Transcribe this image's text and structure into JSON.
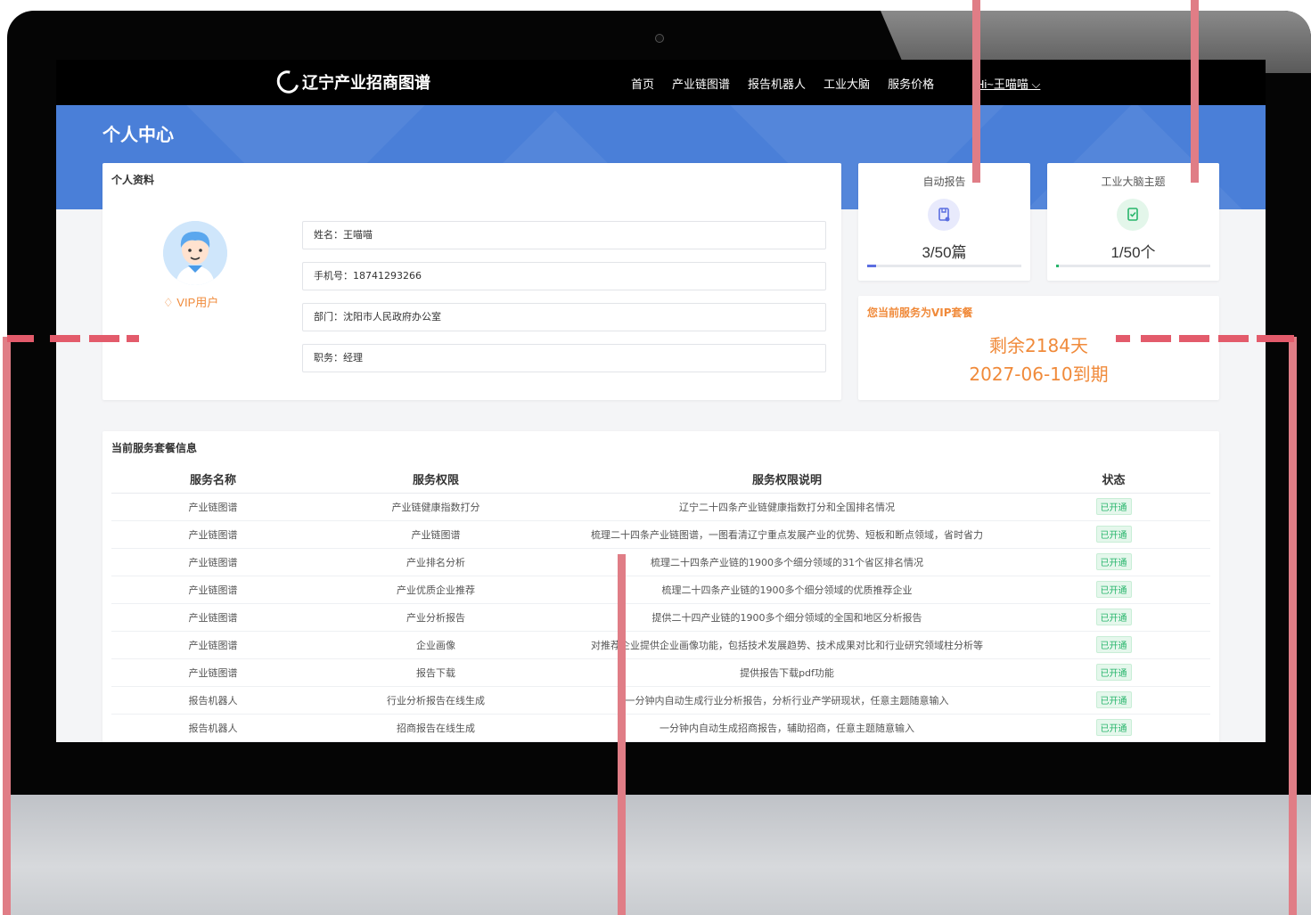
{
  "nav": {
    "logo_text": "辽宁产业招商图谱",
    "items": [
      "首页",
      "产业链图谱",
      "报告机器人",
      "工业大脑",
      "服务价格"
    ],
    "user": "Hi~王喵喵"
  },
  "header": {
    "title": "个人中心"
  },
  "profile": {
    "title": "个人资料",
    "vip_label": "VIP用户",
    "fields": [
      "姓名：王喵喵",
      "手机号：18741293266",
      "部门：沈阳市人民政府办公室",
      "职务：经理"
    ]
  },
  "stats": [
    {
      "label": "自动报告",
      "value": "3/50篇",
      "progress": 0.06,
      "color": "#5b6ee0",
      "icon_bg": "#e8eafc",
      "icon": "report-icon"
    },
    {
      "label": "工业大脑主题",
      "value": "1/50个",
      "progress": 0.02,
      "color": "#27b56b",
      "icon_bg": "#e3f6ea",
      "icon": "brain-topic-icon"
    }
  ],
  "vip": {
    "title": "您当前服务为VIP套餐",
    "days_left": "剩余2184天",
    "expire": "2027-06-10到期"
  },
  "service": {
    "title": "当前服务套餐信息",
    "columns": [
      "服务名称",
      "服务权限",
      "服务权限说明",
      "状态"
    ],
    "rows": [
      [
        "产业链图谱",
        "产业链健康指数打分",
        "辽宁二十四条产业链健康指数打分和全国排名情况",
        "已开通"
      ],
      [
        "产业链图谱",
        "产业链图谱",
        "梳理二十四条产业链图谱，一图看清辽宁重点发展产业的优势、短板和断点领域，省时省力",
        "已开通"
      ],
      [
        "产业链图谱",
        "产业排名分析",
        "梳理二十四条产业链的1900多个细分领域的31个省区排名情况",
        "已开通"
      ],
      [
        "产业链图谱",
        "产业优质企业推荐",
        "梳理二十四条产业链的1900多个细分领域的优质推荐企业",
        "已开通"
      ],
      [
        "产业链图谱",
        "产业分析报告",
        "提供二十四产业链的1900多个细分领域的全国和地区分析报告",
        "已开通"
      ],
      [
        "产业链图谱",
        "企业画像",
        "对推荐企业提供企业画像功能，包括技术发展趋势、技术成果对比和行业研究领域柱分析等",
        "已开通"
      ],
      [
        "产业链图谱",
        "报告下载",
        "提供报告下载pdf功能",
        "已开通"
      ],
      [
        "报告机器人",
        "行业分析报告在线生成",
        "一分钟内自动生成行业分析报告，分析行业产学研现状，任意主题随意输入",
        "已开通"
      ],
      [
        "报告机器人",
        "招商报告在线生成",
        "一分钟内自动生成招商报告，辅助招商，任意主题随意输入",
        "已开通"
      ]
    ]
  }
}
